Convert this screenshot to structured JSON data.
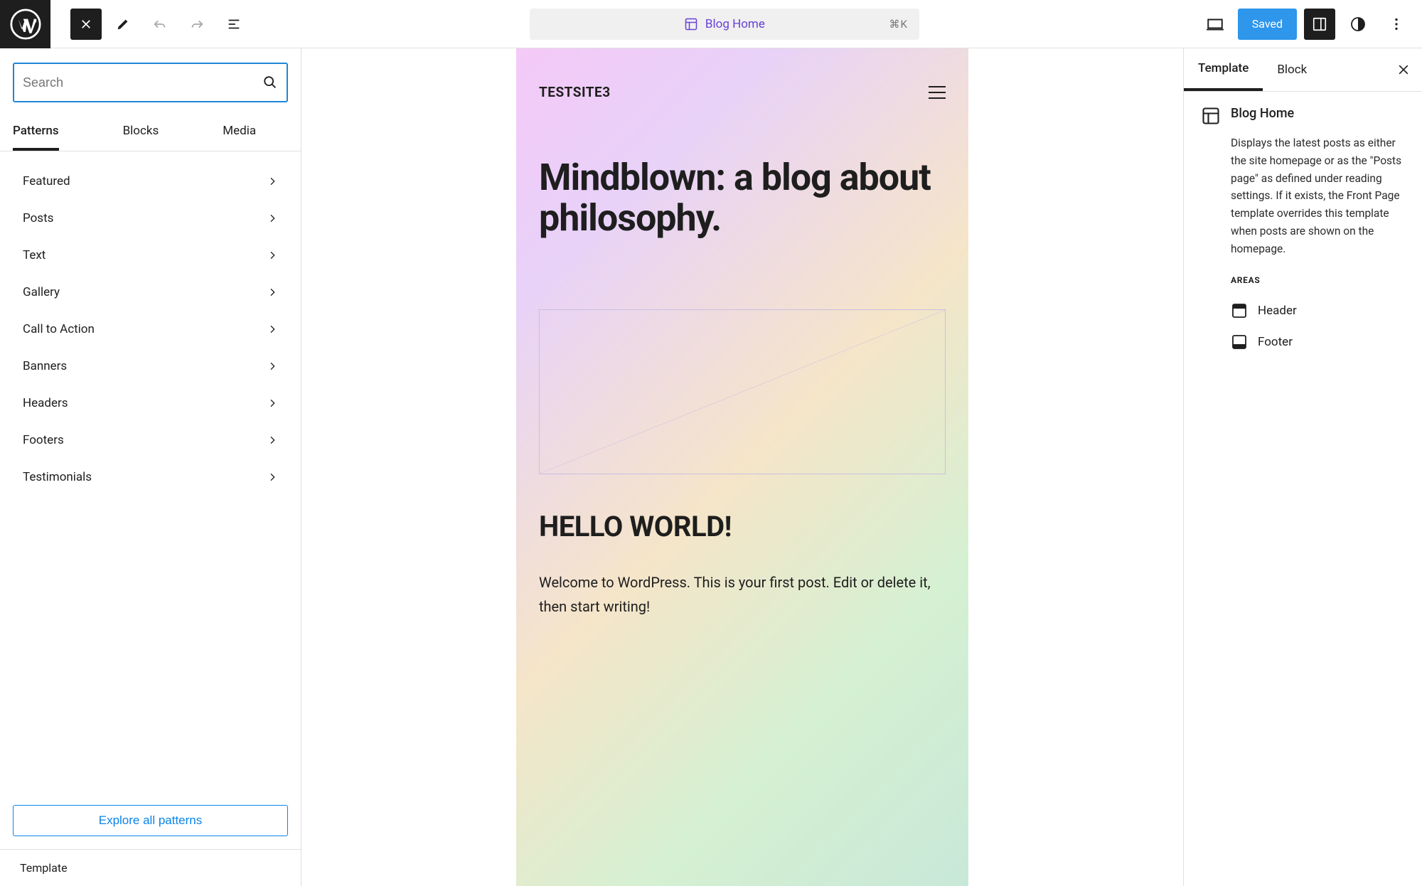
{
  "toolbar": {
    "title": "Blog Home",
    "shortcut": "⌘K",
    "saved_label": "Saved"
  },
  "sidebar_left": {
    "search_placeholder": "Search",
    "tabs": [
      "Patterns",
      "Blocks",
      "Media"
    ],
    "active_tab": 0,
    "categories": [
      "Featured",
      "Posts",
      "Text",
      "Gallery",
      "Call to Action",
      "Banners",
      "Headers",
      "Footers",
      "Testimonials"
    ],
    "explore_label": "Explore all patterns",
    "breadcrumb": "Template"
  },
  "canvas": {
    "site_title": "TESTSITE3",
    "hero": "Mindblown: a blog about philosophy.",
    "post_title": "HELLO WORLD!",
    "post_body": "Welcome to WordPress. This is your first post. Edit or delete it, then start writing!"
  },
  "sidebar_right": {
    "tabs": [
      "Template",
      "Block"
    ],
    "active_tab": 0,
    "template_title": "Blog Home",
    "template_desc": "Displays the latest posts as either the site homepage or as the \"Posts page\" as defined under reading settings. If it exists, the Front Page template overrides this template when posts are shown on the homepage.",
    "areas_label": "AREAS",
    "areas": [
      "Header",
      "Footer"
    ]
  }
}
